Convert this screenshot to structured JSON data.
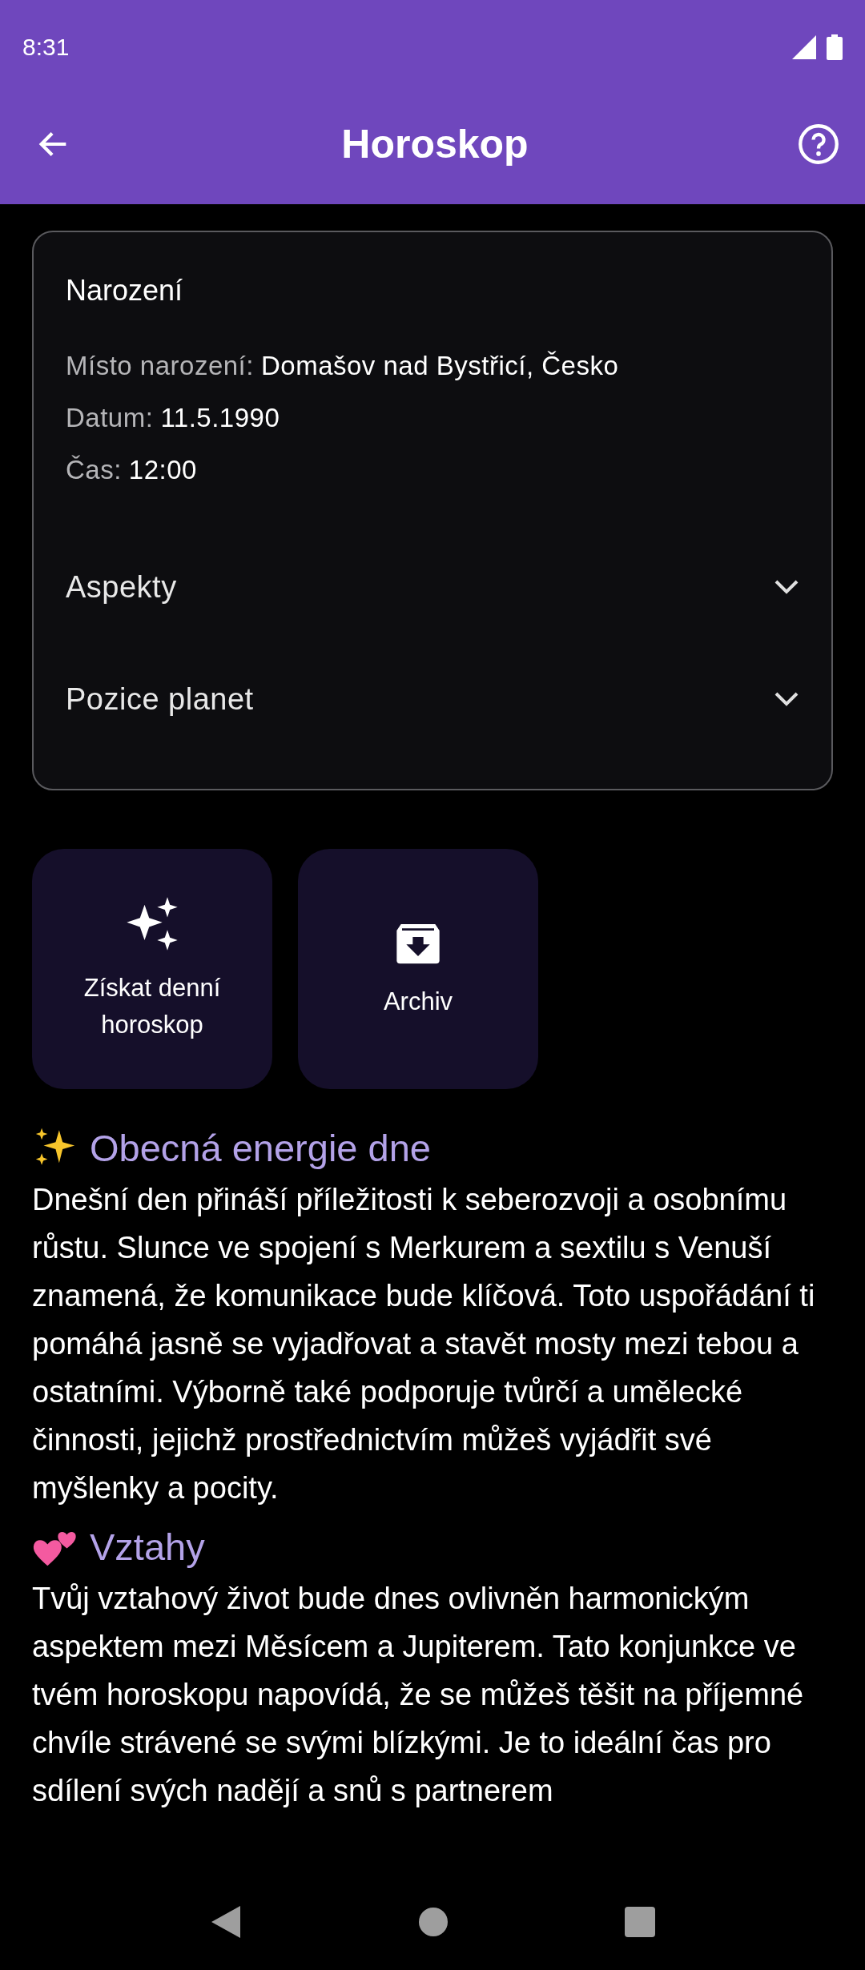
{
  "status_bar": {
    "time": "8:31"
  },
  "app_bar": {
    "title": "Horoskop"
  },
  "birth_card": {
    "title": "Narození",
    "details": [
      {
        "label": "Místo narození:",
        "value": "Domašov nad Bystřicí, Česko"
      },
      {
        "label": "Datum:",
        "value": "11.5.1990"
      },
      {
        "label": "Čas:",
        "value": "12:00"
      }
    ],
    "sections": [
      {
        "label": "Aspekty",
        "expanded": false
      },
      {
        "label": "Pozice planet",
        "expanded": false
      }
    ]
  },
  "actions": [
    {
      "kind": "sparkles",
      "label": "Získat denní horoskop"
    },
    {
      "kind": "archive",
      "label": "Archiv"
    }
  ],
  "horoscope": [
    {
      "kind": "sparkles",
      "heading": "Obecná energie dne",
      "text": "Dnešní den přináší příležitosti k seberozvoji a osobnímu růstu. Slunce ve spojení s Merkurem a sextilu s Venuší znamená, že komunikace bude klíčová. Toto uspořádání ti pomáhá jasně se vyjadřovat a stavět mosty mezi tebou a ostatními. Výborně také podporuje tvůrčí a umělecké činnosti, jejichž prostřednictvím můžeš vyjádřit své myšlenky a pocity."
    },
    {
      "kind": "hearts",
      "heading": "Vztahy",
      "text": "Tvůj vztahový život bude dnes ovlivněn harmonickým aspektem mezi Měsícem a Jupiterem. Tato konjunkce ve tvém horoskopu napovídá, že se můžeš těšit na příjemné chvíle strávené se svými blízkými. Je to ideální čas pro sdílení svých nadějí a snů s partnerem"
    }
  ]
}
